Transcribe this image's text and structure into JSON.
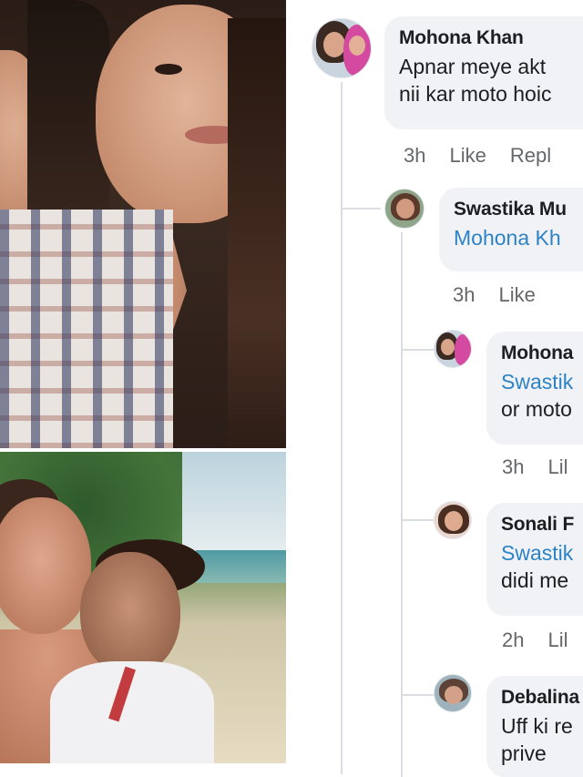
{
  "comments": [
    {
      "id": "c1",
      "author": "Mohona Khan",
      "mention": "",
      "lines": [
        "Apnar meye akt",
        "nii kar moto hoic"
      ],
      "time": "3h",
      "like": "Like",
      "reply": "Repl"
    },
    {
      "id": "c2",
      "author": "Swastika Mu",
      "mention": "Mohona Kh",
      "lines": [],
      "time": "3h",
      "like": "Like",
      "reply": ""
    },
    {
      "id": "c3",
      "author": "Mohona",
      "mention": "Swastik",
      "lines": [
        "or moto"
      ],
      "time": "3h",
      "like": "Lil",
      "reply": ""
    },
    {
      "id": "c4",
      "author": "Sonali F",
      "mention": "Swastik",
      "lines": [
        "didi me"
      ],
      "time": "2h",
      "like": "Lil",
      "reply": ""
    },
    {
      "id": "c5",
      "author": "Debalina",
      "mention": "",
      "lines": [
        "Uff ki re",
        "prive"
      ],
      "time": "",
      "like": "",
      "reply": ""
    }
  ],
  "colors": {
    "bubble": "#f0f2f5",
    "mention": "#2d83c6",
    "meta": "#65676b",
    "thread_line": "#dadde1"
  }
}
